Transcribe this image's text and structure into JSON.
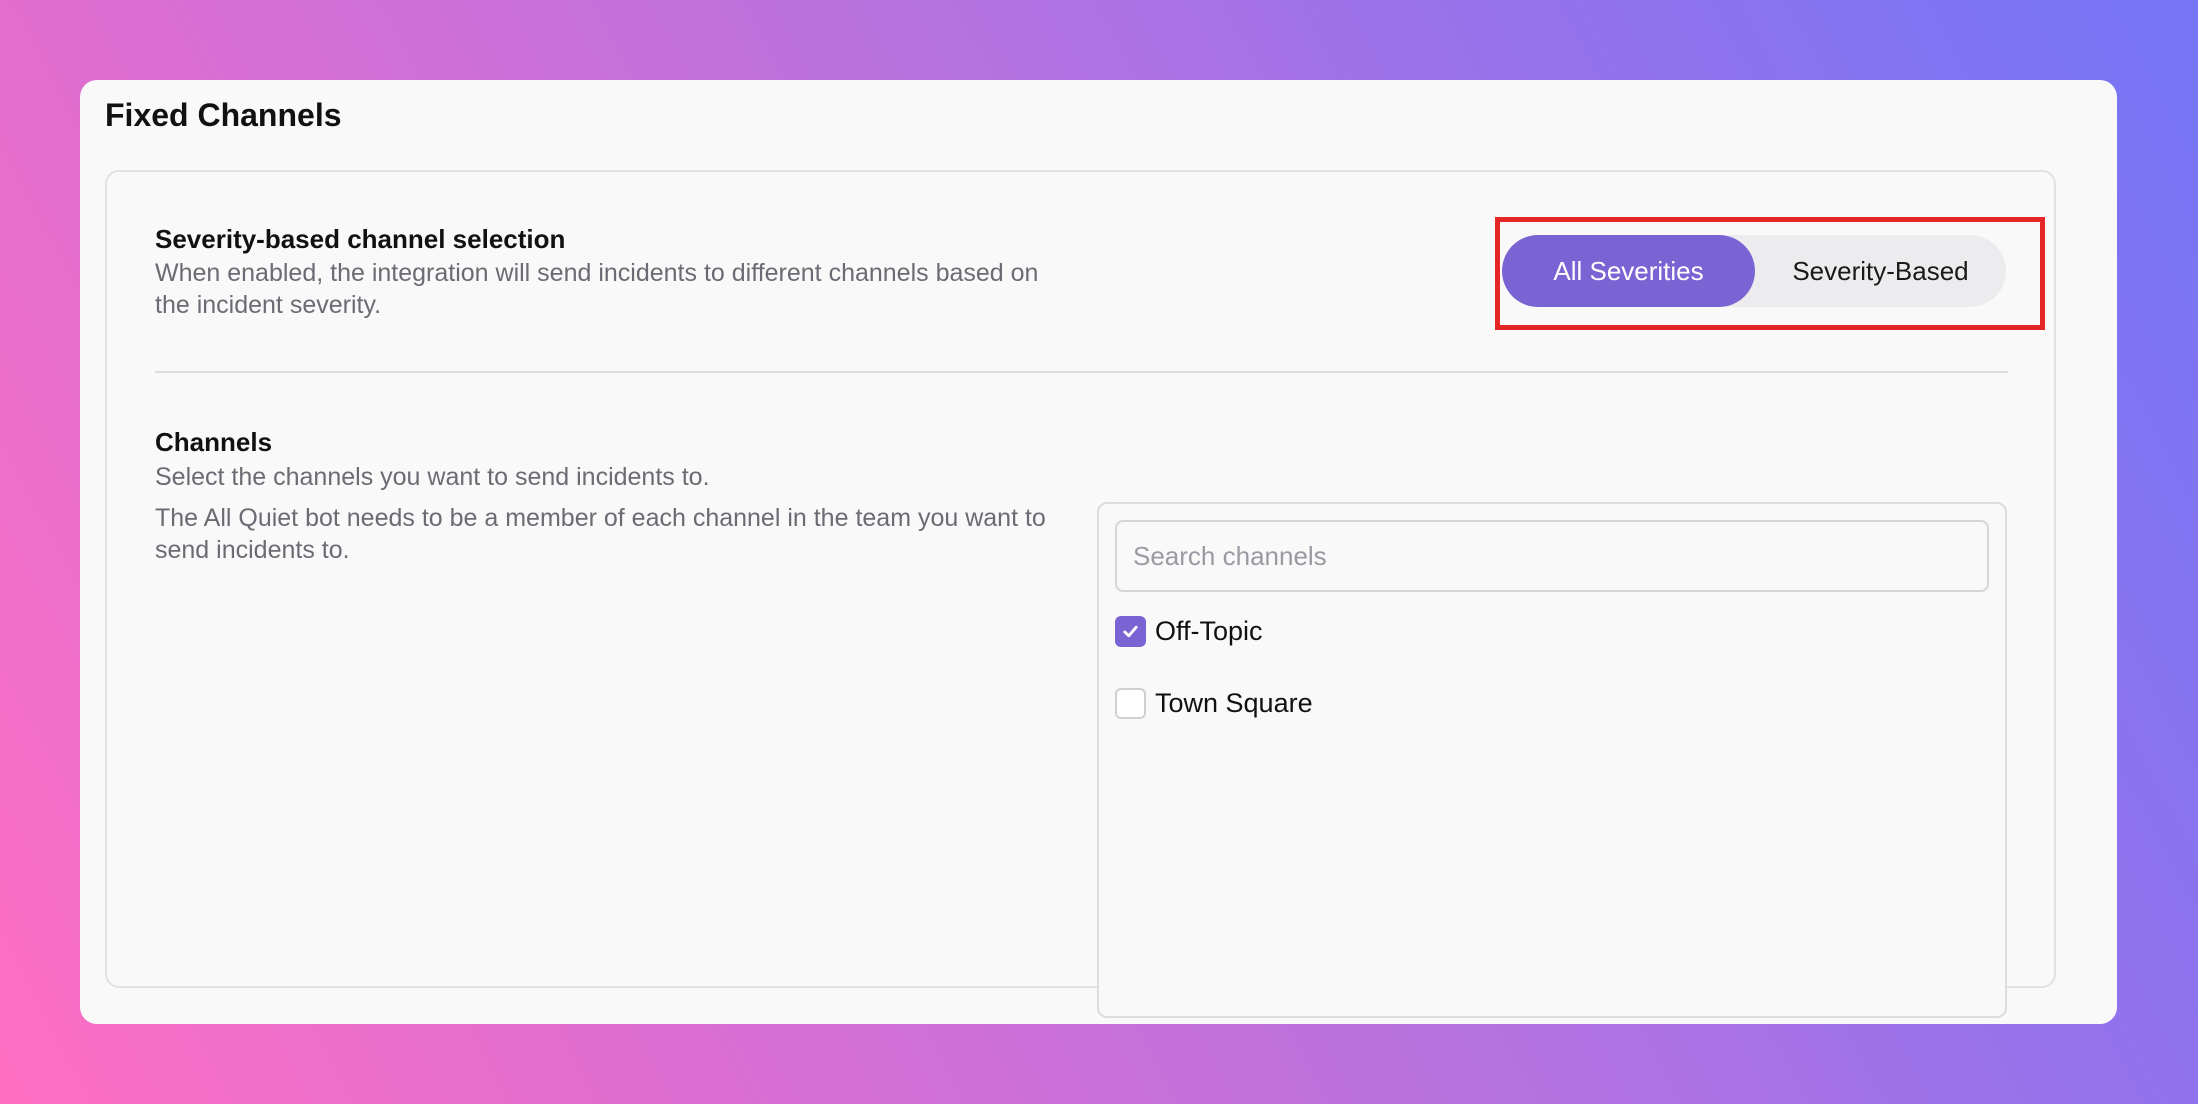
{
  "card": {
    "title": "Fixed Channels"
  },
  "severity_section": {
    "title": "Severity-based channel selection",
    "description": "When enabled, the integration will send incidents to different channels based on the incident severity.",
    "toggle": {
      "options": [
        "All Severities",
        "Severity-Based"
      ],
      "selected": "All Severities"
    }
  },
  "channels_section": {
    "title": "Channels",
    "description_1": "Select the channels you want to send incidents to.",
    "description_2": "The All Quiet bot needs to be a member of each channel in the team you want to send incidents to.",
    "search": {
      "placeholder": "Search channels",
      "value": ""
    },
    "items": [
      {
        "label": "Off-Topic",
        "checked": true
      },
      {
        "label": "Town Square",
        "checked": false
      }
    ]
  },
  "colors": {
    "accent": "#7a63d2",
    "highlight": "#e52626"
  }
}
